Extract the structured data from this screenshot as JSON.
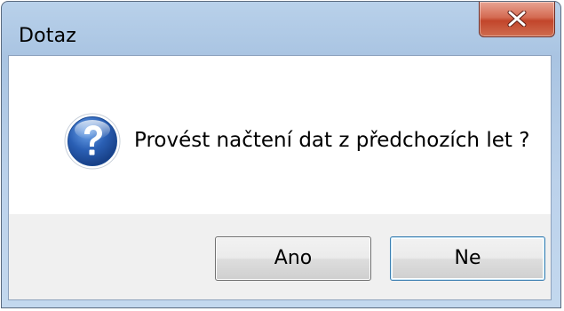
{
  "window": {
    "title": "Dotaz",
    "close_glyph": "x"
  },
  "dialog": {
    "icon": "question-icon",
    "message": "Provést načtení dat z předchozích let ?"
  },
  "buttons": {
    "yes_label": "Ano",
    "no_label": "Ne"
  },
  "colors": {
    "frame": "#b9d1ea",
    "close_button": "#c2452b",
    "icon_blue": "#2a5fb4",
    "default_button_border": "#3c7fb1"
  }
}
